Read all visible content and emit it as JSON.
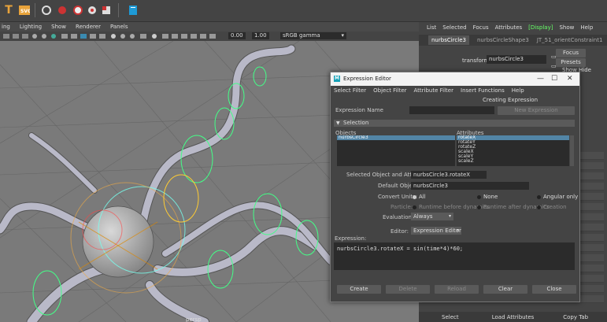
{
  "viewport": {
    "menu": [
      "ing",
      "Lighting",
      "Show",
      "Renderer",
      "Panels"
    ],
    "toolbar_value1": "0.00",
    "toolbar_value2": "1.00",
    "color_space": "sRGB gamma",
    "camera_label": "persp"
  },
  "channel_box": {
    "menu": [
      "List",
      "Selected",
      "Focus",
      "Attributes",
      "[Display]",
      "Show",
      "Help"
    ],
    "tabs": [
      "nurbsCircle3",
      "nurbsCircleShape3",
      "JT_51_orientConstraint1"
    ],
    "transform_label": "transform:",
    "transform_value": "nurbsCircle3",
    "focus_label": "Focus",
    "presets_label": "Presets",
    "show_label": "Show",
    "hide_label": "Hide",
    "bottom_buttons": [
      "Select",
      "Load Attributes",
      "Copy Tab"
    ]
  },
  "expression_editor": {
    "title": "Expression Editor",
    "menu": [
      "Select Filter",
      "Object Filter",
      "Attribute Filter",
      "Insert Functions",
      "Help"
    ],
    "subtitle": "Creating Expression",
    "expression_name_label": "Expression Name",
    "expression_name_value": "",
    "new_expression_label": "New Expression",
    "selection_label": "Selection",
    "objects_label": "Objects",
    "objects": [
      "nurbsCircle3"
    ],
    "attributes_label": "Attributes",
    "attributes": [
      "rotateX",
      "rotateY",
      "rotateZ",
      "scaleX",
      "scaleY",
      "scaleZ"
    ],
    "selected_attr_label": "Selected Object and Attribute:",
    "selected_attr_value": "nurbsCircle3.rotateX",
    "default_object_label": "Default Object:",
    "default_object_value": "nurbsCircle3",
    "convert_units_label": "Convert Units:",
    "convert_units_options": [
      "All",
      "None",
      "Angular only"
    ],
    "particle_label": "Particle:",
    "particle_options": [
      "Runtime before dynamics",
      "Runtime after dynamics",
      "Creation"
    ],
    "evaluation_label": "Evaluation:",
    "evaluation_value": "Always",
    "editor_label": "Editor:",
    "editor_value": "Expression Editor",
    "expression_label": "Expression:",
    "expression_code": "nurbsCircle3.rotateX = sin(time*4)*60;",
    "buttons": [
      "Create",
      "Delete",
      "Reload",
      "Clear",
      "Close"
    ]
  }
}
